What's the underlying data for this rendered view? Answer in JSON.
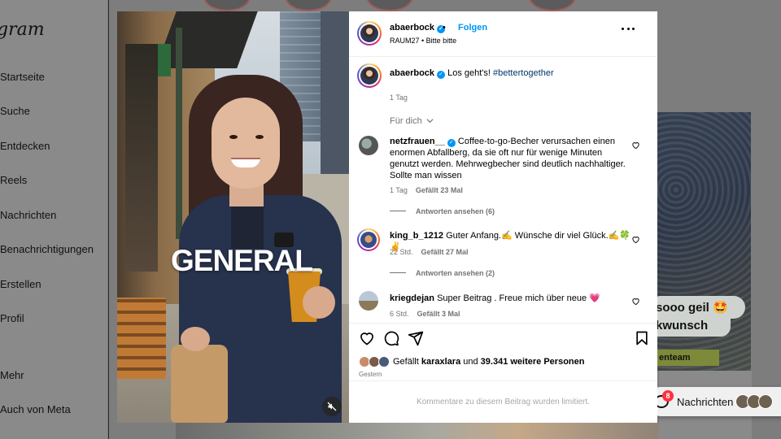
{
  "background": {
    "logo": "gram",
    "nav": [
      "Startseite",
      "Suche",
      "Entdecken",
      "Reels",
      "Nachrichten",
      "Benachrichtigungen",
      "Erstellen",
      "Profil",
      "Mehr",
      "Auch von Meta"
    ],
    "tile_text_1": "sooo geil 🤩",
    "tile_text_2": "kwunsch",
    "tile_banner": "enteam",
    "messages_label": "Nachrichten",
    "messages_badge": "8"
  },
  "post": {
    "overlay_word": "GENERAL",
    "author": "abaerbock",
    "follow_label": "Folgen",
    "location": "RAUM27",
    "audio": "Bitte bitte",
    "caption": {
      "text": "Los geht's!",
      "hashtag": "#bettertogether",
      "time": "1 Tag"
    },
    "for_you_label": "Für dich",
    "comments": [
      {
        "user": "netzfrauen__",
        "verified": true,
        "text": "Coffee-to-go-Becher verursachen einen enormen Abfallberg, da sie oft nur für wenige Minuten genutzt werden. Mehrwegbecher sind deutlich nachhaltiger. Sollte man wissen",
        "time": "1 Tag",
        "likes": "Gefällt 23 Mal",
        "replies": "Antworten ansehen (6)"
      },
      {
        "user": "king_b_1212",
        "verified": false,
        "text": "Guter Anfang.✍️ Wünsche dir viel Glück.✍️🍀✌️",
        "time": "22 Std.",
        "likes": "Gefällt 27 Mal",
        "replies": "Antworten ansehen (2)"
      },
      {
        "user": "kriegdejan",
        "verified": false,
        "text": "Super Beitrag . Freue mich über neue 💗",
        "time": "6 Std.",
        "likes": "Gefällt 3 Mal",
        "replies": ""
      }
    ],
    "likes": {
      "prefix": "Gefällt",
      "user": "karaxlara",
      "connector": "und",
      "count": "39.341 weitere Personen"
    },
    "date": "Gestern",
    "comments_limited": "Kommentare zu diesem Beitrag wurden limitiert."
  },
  "colors": {
    "accent": "#0095f6",
    "secondary_text": "#737373",
    "hashtag": "#00376b"
  }
}
